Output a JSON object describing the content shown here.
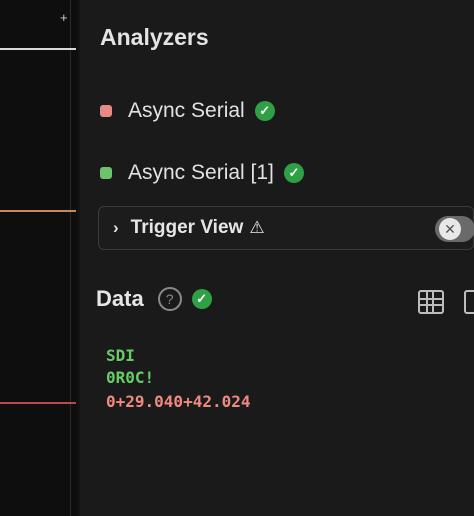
{
  "analyzers": {
    "title": "Analyzers",
    "items": [
      {
        "label": "Async Serial",
        "color": "#e88a84"
      },
      {
        "label": "Async Serial [1]",
        "color": "#6cc36c"
      }
    ],
    "status_icon": "check-circle-icon",
    "status_color": "#2fa043"
  },
  "trigger": {
    "label": "Trigger View",
    "expand_icon": "chevron-right-icon",
    "warning_icon": "warning-icon",
    "close_icon": "close-icon"
  },
  "data_panel": {
    "title": "Data",
    "help_glyph": "?",
    "status_icon": "check-circle-icon",
    "toolbar": [
      "grid-icon",
      "terminal-icon"
    ],
    "lines": [
      {
        "text": "SDI",
        "color": "#66cc66"
      },
      {
        "text": "0R0C!",
        "color": "#66cc66"
      },
      {
        "text": "0+29.040+42.024",
        "color": "#f08a80"
      }
    ]
  },
  "waveform": {
    "marker": "+"
  }
}
